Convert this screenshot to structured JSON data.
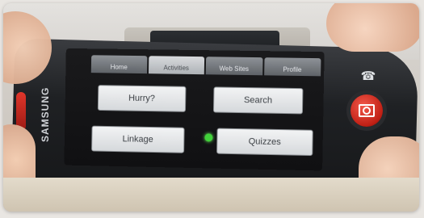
{
  "device": {
    "brand_text": "SAMSUNG"
  },
  "tabs": [
    {
      "label": "Home",
      "active": false
    },
    {
      "label": "Activities",
      "active": true
    },
    {
      "label": "Web Sites",
      "active": false
    },
    {
      "label": "Profile",
      "active": false
    }
  ],
  "buttons": {
    "hurry": "Hurry?",
    "search": "Search",
    "linkage": "Linkage",
    "quizzes": "Quizzes"
  },
  "colors": {
    "indicator": "#41d23a",
    "camera_key": "#d62b1f"
  },
  "icons": {
    "call": "phone-icon",
    "camera": "camera-icon"
  }
}
